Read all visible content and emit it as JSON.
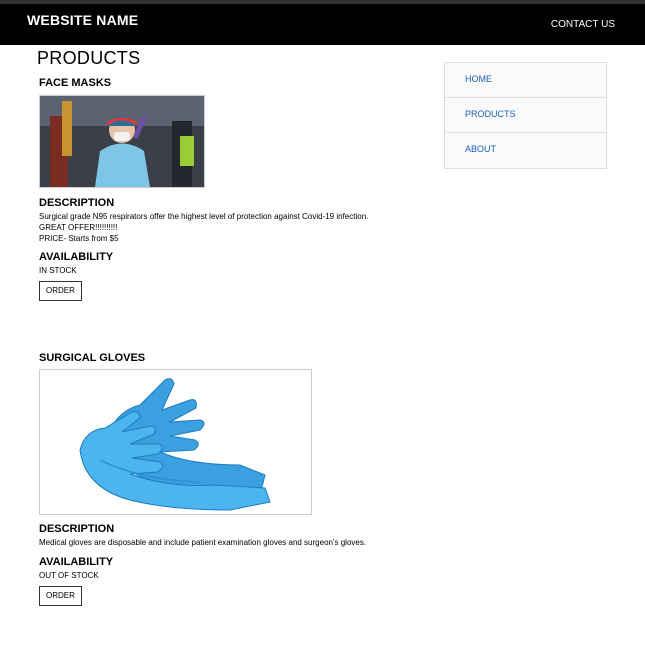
{
  "header": {
    "site_name": "WEBSITE NAME",
    "contact_label": "CONTACT US"
  },
  "main": {
    "title": "PRODUCTS"
  },
  "sidebar": {
    "items": [
      {
        "label": "HOME"
      },
      {
        "label": "PRODUCTS"
      },
      {
        "label": "ABOUT"
      }
    ]
  },
  "products": [
    {
      "name": "FACE MASKS",
      "description_heading": "DESCRIPTION",
      "description_lines": [
        "Surgical grade N95 respirators offer the highest level of protection against Covid-19 infection.",
        "GREAT OFFER!!!!!!!!!!",
        "PRICE- Starts from $5"
      ],
      "availability_heading": "AVAILABILITY",
      "availability": "IN STOCK",
      "order_label": "ORDER"
    },
    {
      "name": "SURGICAL GLOVES",
      "description_heading": "DESCRIPTION",
      "description_lines": [
        "Medical gloves are disposable and include patient examination gloves and surgeon's gloves."
      ],
      "availability_heading": "AVAILABILITY",
      "availability": "OUT OF STOCK",
      "order_label": "ORDER"
    }
  ]
}
